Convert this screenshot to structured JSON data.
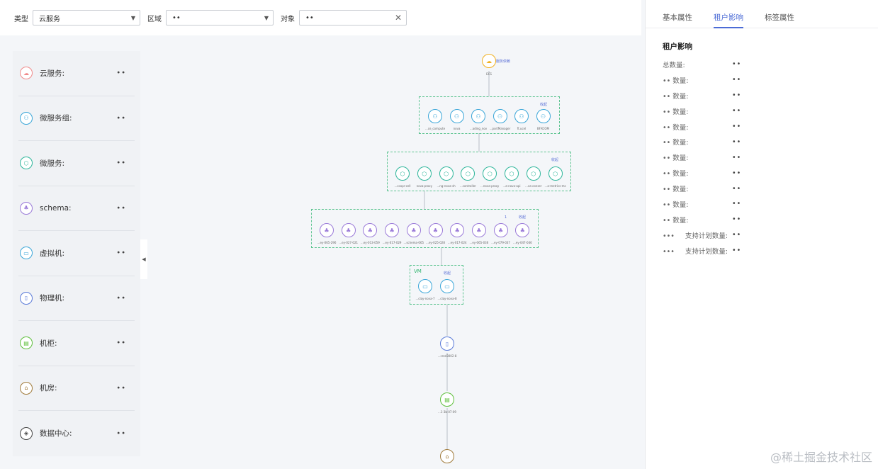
{
  "filters": {
    "type_label": "类型",
    "type_value": "云服务",
    "region_label": "区域",
    "region_value": "••",
    "object_label": "对象",
    "object_value": "••"
  },
  "left_panel": {
    "items": [
      {
        "label": "云服务:",
        "value": "••",
        "color": "#f08a8a"
      },
      {
        "label": "微服务组:",
        "value": "••",
        "color": "#3aa6d8"
      },
      {
        "label": "微服务:",
        "value": "••",
        "color": "#2cb59a"
      },
      {
        "label": "schema:",
        "value": "••",
        "color": "#9a7ad8"
      },
      {
        "label": "虚拟机:",
        "value": "••",
        "color": "#3aa6d8"
      },
      {
        "label": "物理机:",
        "value": "••",
        "color": "#5a7ad8"
      },
      {
        "label": "机柜:",
        "value": "••",
        "color": "#5cbf3a"
      },
      {
        "label": "机房:",
        "value": "••",
        "color": "#a07a3a"
      },
      {
        "label": "数据中心:",
        "value": "••",
        "color": "#444444"
      }
    ]
  },
  "topology": {
    "root_label": "服务依赖",
    "root_sub": "ECS",
    "group_tag": "收起",
    "vm_tag": "VM",
    "microservice_groups": [
      "...ce_compute",
      "nova",
      "...ading_nov",
      "...portManager",
      "ft.ucel",
      "BFXCOM"
    ],
    "microservices": [
      "...ccopr-cell",
      "nova-proxy",
      "...ng-nova-sh",
      "...controller",
      "...nova-proxy",
      "...a-nova-api",
      "...va-conser",
      "...a-metrics-ms"
    ],
    "schemas": [
      "...ey-065-296",
      "...ey-027-021",
      "...ey-013-059",
      "...ey-017-029",
      "...schema-065",
      "...ey-025-028",
      "...ey-017-024",
      "...ey-065-036",
      "...ey-079-037",
      "...ey-047-046"
    ],
    "vms": [
      "...clay-nova-7",
      "...clay-nova-8"
    ],
    "pm_label": "...cred3002-8",
    "rack_label": "...1-3b-07-09",
    "counter": "1"
  },
  "right_panel": {
    "tabs": [
      "基本属性",
      "租户影响",
      "标签属性"
    ],
    "active_tab": 1,
    "title": "租户影响",
    "rows": [
      {
        "label": "总数量:",
        "value": "••"
      },
      {
        "label": "•• 数量:",
        "value": "••"
      },
      {
        "label": "•• 数量:",
        "value": "••"
      },
      {
        "label": "•• 数量:",
        "value": "••"
      },
      {
        "label": "•• 数量:",
        "value": "••"
      },
      {
        "label": "•• 数量:",
        "value": "••"
      },
      {
        "label": "•• 数量:",
        "value": "••"
      },
      {
        "label": "•• 数量:",
        "value": "••"
      },
      {
        "label": "•• 数量:",
        "value": "••"
      },
      {
        "label": "•• 数量:",
        "value": "••"
      },
      {
        "label": "•• 数量:",
        "value": "••"
      },
      {
        "label": "•••     支持计划数量:",
        "value": "••"
      },
      {
        "label": "•••     支持计划数量:",
        "value": "••"
      }
    ]
  },
  "watermark": "@稀土掘金技术社区"
}
